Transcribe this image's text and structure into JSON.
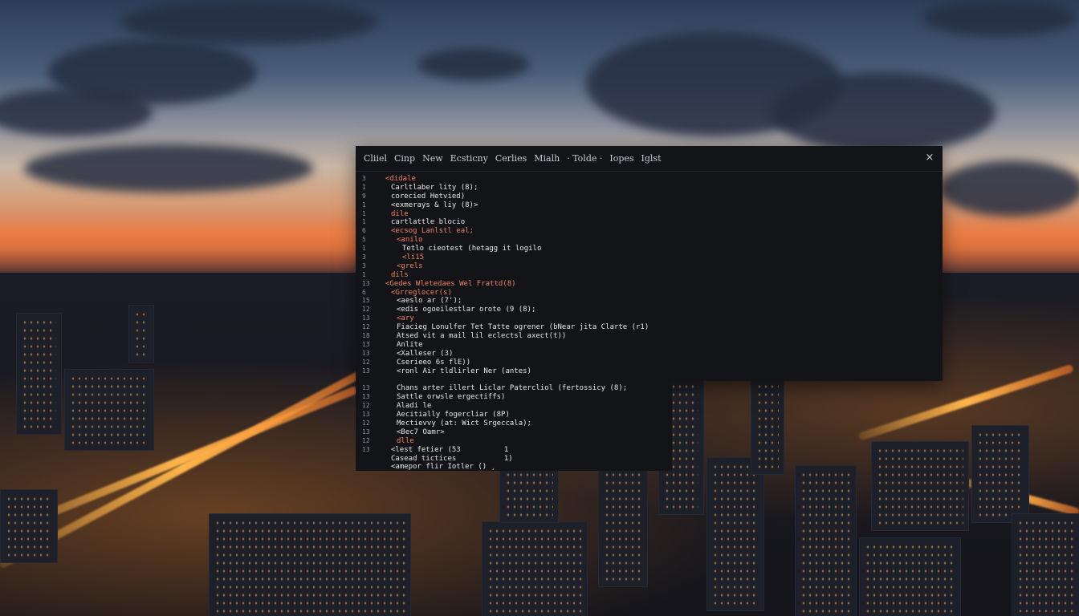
{
  "menu": {
    "items": [
      "Cliiel",
      "Cinp",
      "New",
      "Ecsticny",
      "Cerlies",
      "Mialh",
      "· Tolde ·",
      "Iopes",
      "Iglst"
    ]
  },
  "code": {
    "lines": [
      {
        "n": "3",
        "text": "<didale",
        "kind": "tag",
        "indent": 1
      },
      {
        "n": "1",
        "text": "Carltlaber lity (8);",
        "kind": "plain",
        "indent": 2
      },
      {
        "n": "9",
        "text": "corecied Hetvied)",
        "kind": "plain",
        "indent": 2
      },
      {
        "n": "1",
        "text": "<exmerays & liy (8)>",
        "kind": "plain",
        "indent": 2
      },
      {
        "n": "1",
        "text": "dile",
        "kind": "tag",
        "indent": 2
      },
      {
        "n": "1",
        "text": "cartlattle blocio",
        "kind": "plain",
        "indent": 2
      },
      {
        "n": "6",
        "text": "<ecsog Lanlstl eal;",
        "kind": "tag",
        "indent": 2
      },
      {
        "n": "5",
        "text": "<anilo",
        "kind": "tag",
        "indent": 3
      },
      {
        "n": "1",
        "text": "Tetlo cieotest (hetagg it logilo",
        "kind": "plain",
        "indent": 4
      },
      {
        "n": "3",
        "text": "<li15",
        "kind": "tag",
        "indent": 4
      },
      {
        "n": "3",
        "text": "<grels",
        "kind": "tag",
        "indent": 3
      },
      {
        "n": "1",
        "text": "dils",
        "kind": "tag",
        "indent": 2
      },
      {
        "n": "13",
        "text": "<Gedes Wletedaes Wel Frattd(8)",
        "kind": "tag",
        "indent": 1
      },
      {
        "n": "6",
        "text": "<Grreglocer(s)",
        "kind": "tag",
        "indent": 2
      },
      {
        "n": "15",
        "text": "<aeslo ar (7');",
        "kind": "plain",
        "indent": 3
      },
      {
        "n": "12",
        "text": "<edis ogoeilestlar orote (9 (8);",
        "kind": "plain",
        "indent": 3
      },
      {
        "n": "13",
        "text": "<ary",
        "kind": "tag",
        "indent": 3
      },
      {
        "n": "12",
        "text": "Fiacieg Lonulfer Tet Tatte ogrener (bNear jita Clarte (r1)",
        "kind": "plain",
        "indent": 3
      },
      {
        "n": "18",
        "text": "Atsed vit a mail lil eclectsl axect(t))",
        "kind": "plain",
        "indent": 3
      },
      {
        "n": "13",
        "text": "Anlite",
        "kind": "plain",
        "indent": 3
      },
      {
        "n": "13",
        "text": "<Xalleser (3)",
        "kind": "plain",
        "indent": 3
      },
      {
        "n": "12",
        "text": "Cserieeo 6s flE))",
        "kind": "plain",
        "indent": 3
      },
      {
        "n": "13",
        "text": "<ronl Air tldlirler Ner (antes)",
        "kind": "plain",
        "indent": 3
      },
      {
        "n": "",
        "text": "",
        "kind": "plain",
        "indent": 3
      },
      {
        "n": "13",
        "text": "Chans arter illert Liclar Patercliol (fertossicy (8);",
        "kind": "plain",
        "indent": 3
      },
      {
        "n": "13",
        "text": "Sattle orwsle ergectiffs)",
        "kind": "plain",
        "indent": 3
      },
      {
        "n": "12",
        "text": "Aladi le",
        "kind": "plain",
        "indent": 3
      },
      {
        "n": "13",
        "text": "Aecitially fogercliar (8P)",
        "kind": "plain",
        "indent": 3
      },
      {
        "n": "12",
        "text": "Mectievvy (at: Wict Srgeccala);",
        "kind": "plain",
        "indent": 3
      },
      {
        "n": "13",
        "text": "<Bec7 Oamr>",
        "kind": "plain",
        "indent": 3
      },
      {
        "n": "12",
        "text": "dlle",
        "kind": "tag",
        "indent": 3
      },
      {
        "n": "13",
        "text": "<lest fetier (53          1",
        "kind": "plain",
        "indent": 2
      },
      {
        "n": "",
        "text": "Casead tictices           1)",
        "kind": "plain",
        "indent": 2
      },
      {
        "n": "",
        "text": "<amepor flir Iotler () ¸",
        "kind": "plain",
        "indent": 2
      }
    ]
  },
  "window": {
    "close_label": "×"
  }
}
